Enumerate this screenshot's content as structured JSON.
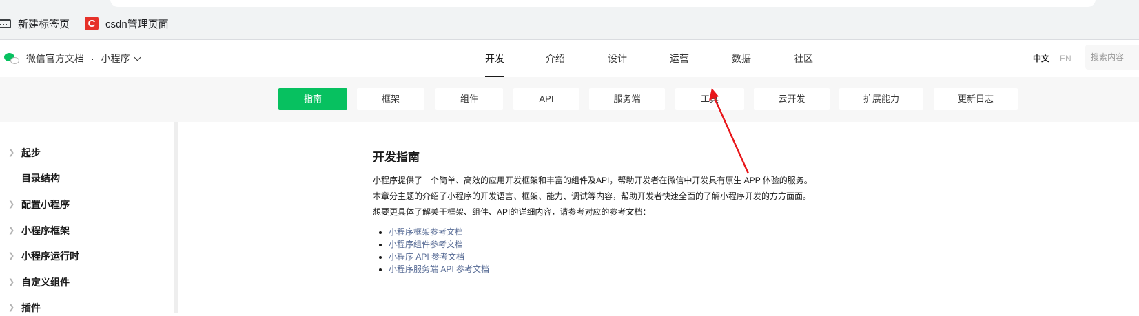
{
  "browser": {
    "bookmarks": [
      {
        "label": "新建标签页",
        "icon": "tabs-icon"
      },
      {
        "label": "csdn管理页面",
        "icon": "csdn-icon",
        "icon_char": "C",
        "icon_color": "#e63129"
      }
    ]
  },
  "topnav": {
    "brand": "微信官方文档",
    "separator": "·",
    "product": "小程序",
    "tabs": [
      "开发",
      "介绍",
      "设计",
      "运营",
      "数据",
      "社区"
    ],
    "active_tab": "开发",
    "lang_cn": "中文",
    "lang_en": "EN",
    "search_placeholder": "搜索内容"
  },
  "subnav": {
    "items": [
      "指南",
      "框架",
      "组件",
      "API",
      "服务端",
      "工具",
      "云开发",
      "扩展能力",
      "更新日志"
    ],
    "active": "指南"
  },
  "sidebar": {
    "items": [
      {
        "label": "起步",
        "expandable": true
      },
      {
        "label": "目录结构",
        "expandable": false
      },
      {
        "label": "配置小程序",
        "expandable": true
      },
      {
        "label": "小程序框架",
        "expandable": true
      },
      {
        "label": "小程序运行时",
        "expandable": true
      },
      {
        "label": "自定义组件",
        "expandable": true
      },
      {
        "label": "插件",
        "expandable": true
      }
    ]
  },
  "content": {
    "title": "开发指南",
    "paragraphs": [
      "小程序提供了一个简单、高效的应用开发框架和丰富的组件及API，帮助开发者在微信中开发具有原生 APP 体验的服务。",
      "本章分主题的介绍了小程序的开发语言、框架、能力、调试等内容，帮助开发者快速全面的了解小程序开发的方方面面。",
      "想要更具体了解关于框架、组件、API的详细内容，请参考对应的参考文档："
    ],
    "links": [
      "小程序框架参考文档",
      "小程序组件参考文档",
      "小程序 API 参考文档",
      "小程序服务端 API 参考文档"
    ]
  },
  "colors": {
    "accent": "#07c160",
    "link": "#576b95",
    "annotation_arrow": "#e8171b"
  }
}
